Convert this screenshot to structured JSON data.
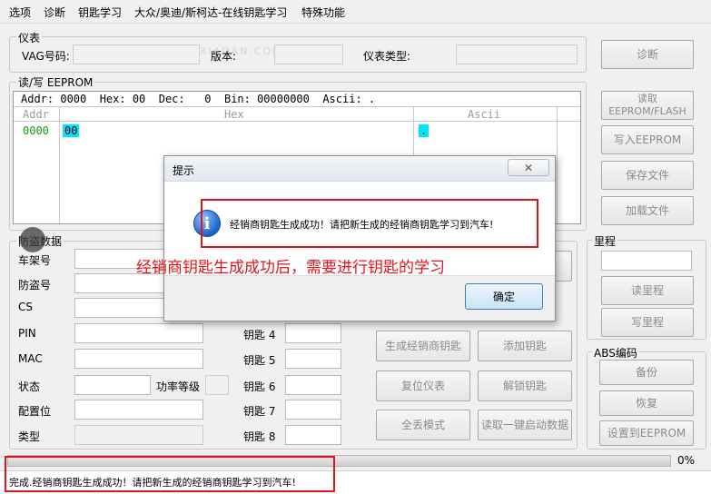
{
  "menu": [
    "选项",
    "诊断",
    "钥匙学习",
    "大众/奥迪/斯柯达-在线钥匙学习",
    "特殊功能"
  ],
  "watermark": "SHOUXIADAN.COM",
  "instrument": {
    "title": "仪表",
    "vag_label": "VAG号码:",
    "version_label": "版本:",
    "type_label": "仪表类型:",
    "diagnose_button": "诊断"
  },
  "eeprom": {
    "title": "读/写 EEPROM",
    "status": "Addr: 0000  Hex: 00  Dec:   0  Bin: 00000000  Ascii: .",
    "col_addr": "Addr",
    "col_hex": "Hex",
    "col_ascii": "Ascii",
    "row_addr": "0000",
    "row_hex": "00",
    "row_ascii": ".",
    "read_button": "读取\nEEPROM/FLASH",
    "write_button": "写入EEPROM",
    "save_button": "保存文件",
    "load_button": "加载文件"
  },
  "immo": {
    "title": "防盗数据",
    "vin_label": "车架号",
    "immo_label": "防盗号",
    "cs_label": "CS",
    "pin_label": "PIN",
    "mac_label": "MAC",
    "status_label": "状态",
    "power_label": "功率等级",
    "config_label": "配置位",
    "type_label": "类型"
  },
  "keys": [
    "钥匙 4",
    "钥匙 5",
    "钥匙 6",
    "钥匙 7",
    "钥匙 8"
  ],
  "actions": {
    "gen_dealer_key": "生成经销商钥匙",
    "add_key": "添加钥匙",
    "reset_cluster": "复位仪表",
    "unlock_key": "解锁钥匙",
    "all_lost": "全丢模式",
    "read_one_key": "读取一键启动数据"
  },
  "mileage": {
    "title": "里程",
    "read_button": "读里程",
    "write_button": "写里程"
  },
  "abs": {
    "title": "ABS编码",
    "backup_button": "备份",
    "restore_button": "恢复",
    "set_button": "设置到EEPROM"
  },
  "dialog": {
    "title": "提示",
    "close": "✕",
    "message": "经销商钥匙生成成功！请把新生成的经销商钥匙学习到汽车!",
    "ok": "确定",
    "info_glyph": "i"
  },
  "annotation": "经销商钥匙生成成功后，需要进行钥匙的学习",
  "progress": {
    "value": 0,
    "label": "0%"
  },
  "status_message": "完成.经销商钥匙生成成功！请把新生成的经销商钥匙学习到汽车!",
  "colors": {
    "accent_red": "#e2141b",
    "ascii_cyan": "#00e5ff",
    "addr_green": "#109e10",
    "info_blue": "#1c64c8"
  }
}
